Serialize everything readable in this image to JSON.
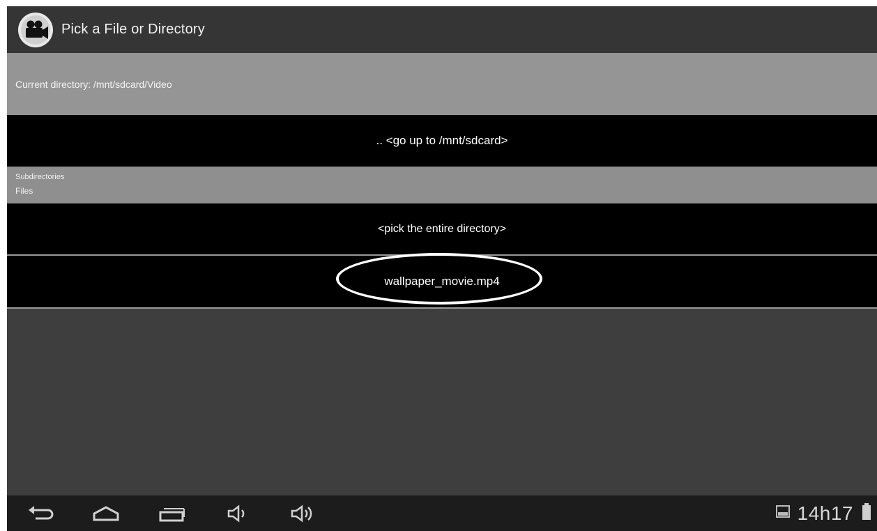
{
  "titlebar": {
    "app_icon": "video-camera-icon",
    "title": "Pick a File or Directory"
  },
  "current_directory": {
    "text": "Current directory: /mnt/sdcard/Video"
  },
  "rows": {
    "go_up": ".. <go up to /mnt/sdcard>",
    "pick_directory": "<pick the entire directory>",
    "file": "wallpaper_movie.mp4"
  },
  "section_header": {
    "line1": "Subdirectories",
    "line2": "Files"
  },
  "navbar": {
    "buttons": [
      "back-icon",
      "home-icon",
      "recent-apps-icon",
      "volume-down-icon",
      "volume-up-icon"
    ]
  },
  "status": {
    "time": "14h17",
    "icons": [
      "gallery-icon",
      "battery-icon"
    ]
  },
  "colors": {
    "titlebar": "#353535",
    "current_dir_bar": "#959595",
    "list_row": "#000000",
    "background": "#3d3d3d",
    "navbar": "#1c1c1c",
    "highlight": "#ffffff"
  }
}
